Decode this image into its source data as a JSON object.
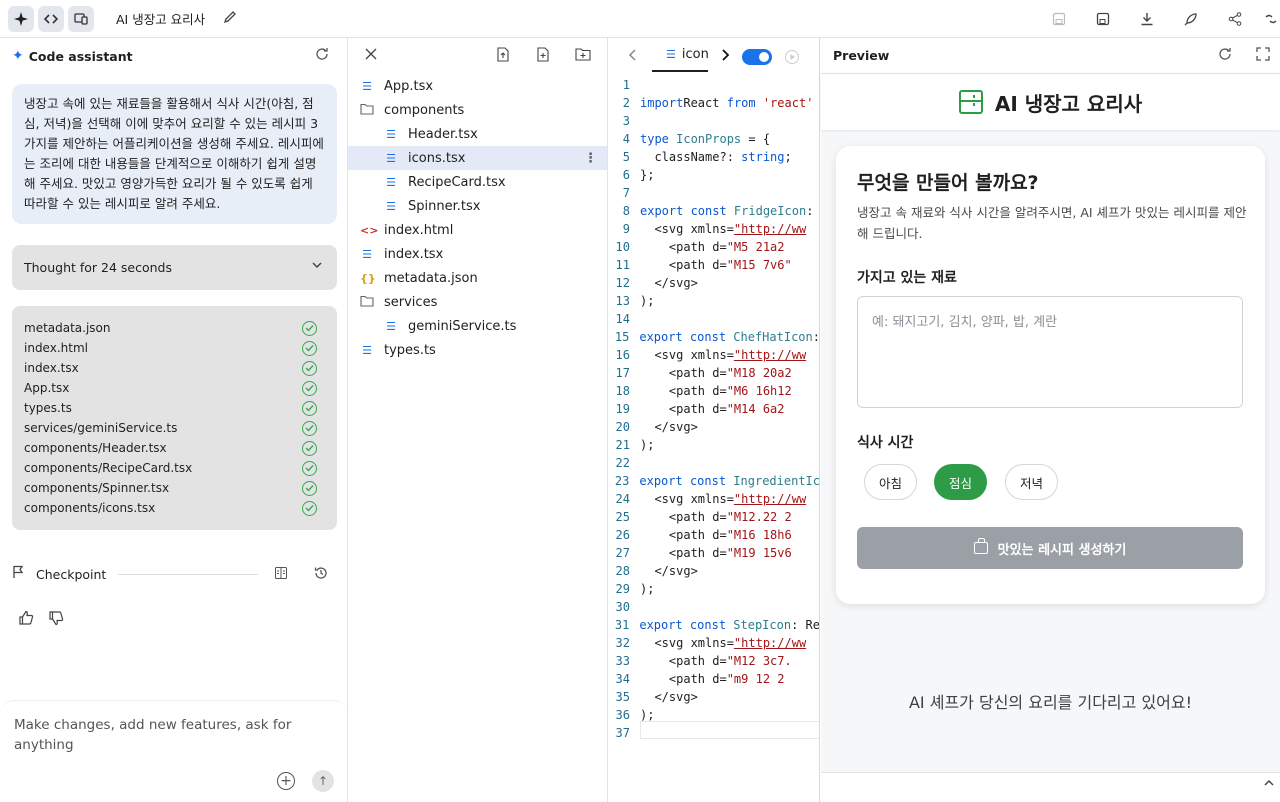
{
  "topbar": {
    "project_title": "AI 냉장고 요리사",
    "icons": [
      "sparkle-icon",
      "code-icon",
      "device-icon",
      "pencil-icon",
      "save-icon",
      "save-as-icon",
      "download-icon",
      "deploy-rocket-icon",
      "share-icon",
      "link-icon"
    ]
  },
  "assistant": {
    "title": "Code assistant",
    "prompt": "냉장고 속에 있는 재료들을 활용해서 식사 시간(아침, 점심, 저녁)을 선택해 이에 맞추어 요리할 수 있는 레시피 3가지를 제안하는 어플리케이션을 생성해 주세요. 레시피에는 조리에 대한 내용들을 단계적으로 이해하기 쉽게 설명해 주세요. 맛있고 영양가득한 요리가 될 수 있도록 쉽게 따라할 수 있는 레시피로 알려 주세요.",
    "thought_label": "Thought for 24 seconds",
    "generated_files": [
      "metadata.json",
      "index.html",
      "index.tsx",
      "App.tsx",
      "types.ts",
      "services/geminiService.ts",
      "components/Header.tsx",
      "components/RecipeCard.tsx",
      "components/Spinner.tsx",
      "components/icons.tsx"
    ],
    "checkpoint_label": "Checkpoint",
    "composer_placeholder": "Make changes, add new features, ask for anything"
  },
  "file_tree": {
    "items": [
      {
        "name": "App.tsx",
        "type": "file",
        "depth": 0
      },
      {
        "name": "components",
        "type": "folder",
        "depth": 0
      },
      {
        "name": "Header.tsx",
        "type": "file",
        "depth": 1
      },
      {
        "name": "icons.tsx",
        "type": "file",
        "depth": 1,
        "selected": true
      },
      {
        "name": "RecipeCard.tsx",
        "type": "file",
        "depth": 1
      },
      {
        "name": "Spinner.tsx",
        "type": "file",
        "depth": 1
      },
      {
        "name": "index.html",
        "type": "html",
        "depth": 0
      },
      {
        "name": "index.tsx",
        "type": "file",
        "depth": 0
      },
      {
        "name": "metadata.json",
        "type": "json",
        "depth": 0
      },
      {
        "name": "services",
        "type": "folder",
        "depth": 0
      },
      {
        "name": "geminiService.ts",
        "type": "file",
        "depth": 1
      },
      {
        "name": "types.ts",
        "type": "file",
        "depth": 0
      }
    ]
  },
  "editor": {
    "tab_label": "icon",
    "lines": [
      [],
      [
        [
          "kw",
          "import"
        ],
        [
          "",
          "React "
        ],
        [
          "kw",
          "from"
        ],
        [
          "str",
          " 'react'"
        ]
      ],
      [],
      [
        [
          "kw",
          "type"
        ],
        [
          "ty",
          " IconProps"
        ],
        [
          "",
          " = {"
        ]
      ],
      [
        [
          "",
          "  className?: "
        ],
        [
          "kw",
          "string"
        ],
        [
          "",
          ";"
        ]
      ],
      [
        [
          "",
          "};"
        ]
      ],
      [],
      [
        [
          "kw",
          "export const"
        ],
        [
          "ty",
          " FridgeIcon"
        ],
        [
          "",
          ":"
        ]
      ],
      [
        [
          "",
          "  <svg xmlns="
        ],
        [
          "url",
          "\"http://ww"
        ]
      ],
      [
        [
          "",
          "    <path d="
        ],
        [
          "str",
          "\"M5 21a2"
        ]
      ],
      [
        [
          "",
          "    <path d="
        ],
        [
          "str",
          "\"M15 7v6\""
        ]
      ],
      [
        [
          "",
          "  </svg>"
        ]
      ],
      [
        [
          "",
          ");"
        ]
      ],
      [],
      [
        [
          "kw",
          "export const"
        ],
        [
          "ty",
          " ChefHatIcon"
        ],
        [
          "",
          ":"
        ]
      ],
      [
        [
          "",
          "  <svg xmlns="
        ],
        [
          "url",
          "\"http://ww"
        ]
      ],
      [
        [
          "",
          "    <path d="
        ],
        [
          "str",
          "\"M18 20a2"
        ]
      ],
      [
        [
          "",
          "    <path d="
        ],
        [
          "str",
          "\"M6 16h12"
        ]
      ],
      [
        [
          "",
          "    <path d="
        ],
        [
          "str",
          "\"M14 6a2"
        ]
      ],
      [
        [
          "",
          "  </svg>"
        ]
      ],
      [
        [
          "",
          ");"
        ]
      ],
      [],
      [
        [
          "kw",
          "export const"
        ],
        [
          "ty",
          " IngredientIc"
        ]
      ],
      [
        [
          "",
          "  <svg xmlns="
        ],
        [
          "url",
          "\"http://ww"
        ]
      ],
      [
        [
          "",
          "    <path d="
        ],
        [
          "str",
          "\"M12.22 2"
        ]
      ],
      [
        [
          "",
          "    <path d="
        ],
        [
          "str",
          "\"M16 18h6"
        ]
      ],
      [
        [
          "",
          "    <path d="
        ],
        [
          "str",
          "\"M19 15v6"
        ]
      ],
      [
        [
          "",
          "  </svg>"
        ]
      ],
      [
        [
          "",
          ");"
        ]
      ],
      [],
      [
        [
          "kw",
          "export const"
        ],
        [
          "ty",
          " StepIcon"
        ],
        [
          "",
          ": Re"
        ]
      ],
      [
        [
          "",
          "  <svg xmlns="
        ],
        [
          "url",
          "\"http://ww"
        ]
      ],
      [
        [
          "",
          "    <path d="
        ],
        [
          "str",
          "\"M12 3c7."
        ]
      ],
      [
        [
          "",
          "    <path d="
        ],
        [
          "str",
          "\"m9 12 2"
        ]
      ],
      [
        [
          "",
          "  </svg>"
        ]
      ],
      [
        [
          "",
          ");"
        ]
      ],
      []
    ]
  },
  "preview": {
    "title": "Preview",
    "app_title": "AI 냉장고 요리사",
    "card_heading": "무엇을 만들어 볼까요?",
    "card_desc": "냉장고 속 재료와 식사 시간을 알려주시면, AI 셰프가 맛있는 레시피를 제안해 드립니다.",
    "ingredients_label": "가지고 있는 재료",
    "ingredients_placeholder": "예: 돼지고기, 김치, 양파, 밥, 계란",
    "meal_label": "식사 시간",
    "meal_options": [
      "아침",
      "점심",
      "저녁"
    ],
    "meal_selected": "점심",
    "generate_button": "맛있는 레시피 생성하기",
    "waiting_text": "AI 셰프가 당신의 요리를 기다리고 있어요!",
    "accent_color": "#2e9b47"
  }
}
